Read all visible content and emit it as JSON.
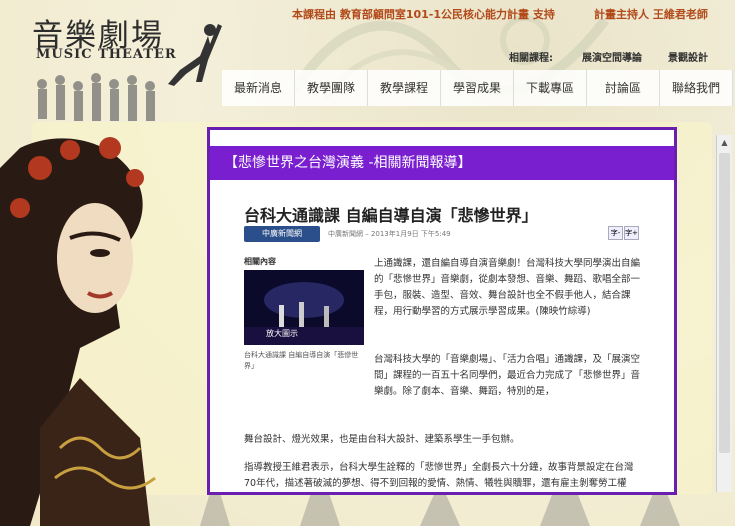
{
  "header": {
    "logo_zh": "音樂劇場",
    "logo_en": "MUSIC THEATER",
    "notice_left": "本課程由 教育部顧問室101-1公民核心能力計畫 支持",
    "notice_right": "計畫主持人 王維君老師",
    "related_label": "相關課程:",
    "related_links": [
      "展演空間導論",
      "景觀設計"
    ]
  },
  "nav": {
    "items": [
      "最新消息",
      "教學團隊",
      "教學課程",
      "學習成果",
      "下載專區",
      "討論區",
      "聯絡我們"
    ]
  },
  "panel": {
    "heading": "【悲慘世界之台灣演義 -相關新聞報導】"
  },
  "article": {
    "title": "台科大通識課 自編自導自演「悲慘世界」",
    "source_logo": "中廣新聞網",
    "meta": "中廣新聞網 – 2013年1月9日 下午5:49",
    "font_buttons": [
      "字-",
      "字+"
    ],
    "related_label": "相關內容",
    "photo_caption_overlay": "放大圖示",
    "photo_caption": "台科大通識課 自編自導自演「悲慘世界」",
    "paragraphs": [
      "上通識課，還自編自導自演音樂劇！台灣科技大學同學演出自編的「悲慘世界」音樂劇，從劇本發想、音樂、舞蹈、歌唱全部一手包，服裝、造型、音效、舞台設計也全不假手他人，結合課程，用行動學習的方式展示學習成果。(陳映竹綜導)",
      "台灣科技大學的「音樂劇場」、「活力合唱」通識課，及「展演空間」課程的一百五十名同學們，最近合力完成了「悲慘世界」音樂劇。除了劇本、音樂、舞蹈，特別的是，",
      "舞台設計、燈光效果，也是由台科大設計、建築系學生一手包辦。",
      "指導教授王維君表示，台科大學生詮釋的「悲慘世界」全劇長六十分鐘，故事背景設定在台灣70年代，描述著破滅的夢想、得不到回報的愛情、熱情、犧牲與贖罪，還有雇主剝奪勞工權益，勞工團結起來對抗不平等工資，要求加薪等劇情。"
    ]
  },
  "colors": {
    "accent_purple": "#7a1fd0",
    "notice_orange": "#b24a1a"
  }
}
